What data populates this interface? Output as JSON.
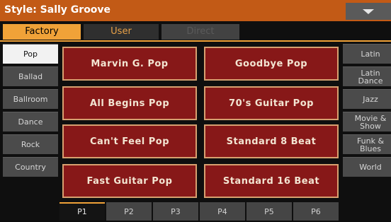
{
  "title": "Style: Sally Groove",
  "banks": [
    "Factory",
    "User",
    "Direct"
  ],
  "left_categories": [
    "Pop",
    "Ballad",
    "Ballroom",
    "Dance",
    "Rock",
    "Country"
  ],
  "right_categories": [
    "Latin",
    "Latin Dance",
    "Jazz",
    "Movie & Show",
    "Funk & Blues",
    "World"
  ],
  "styles": [
    "Marvin G. Pop",
    "Goodbye Pop",
    "All Begins Pop",
    "70's Guitar Pop",
    "Can't Feel Pop",
    "Standard 8 Beat",
    "Fast Guitar Pop",
    "Standard 16 Beat"
  ],
  "pages": [
    "P1",
    "P2",
    "P3",
    "P4",
    "P5",
    "P6"
  ],
  "colors": {
    "title_bar": "#c25a16",
    "accent": "#f0a238",
    "style_button": "#871818"
  }
}
